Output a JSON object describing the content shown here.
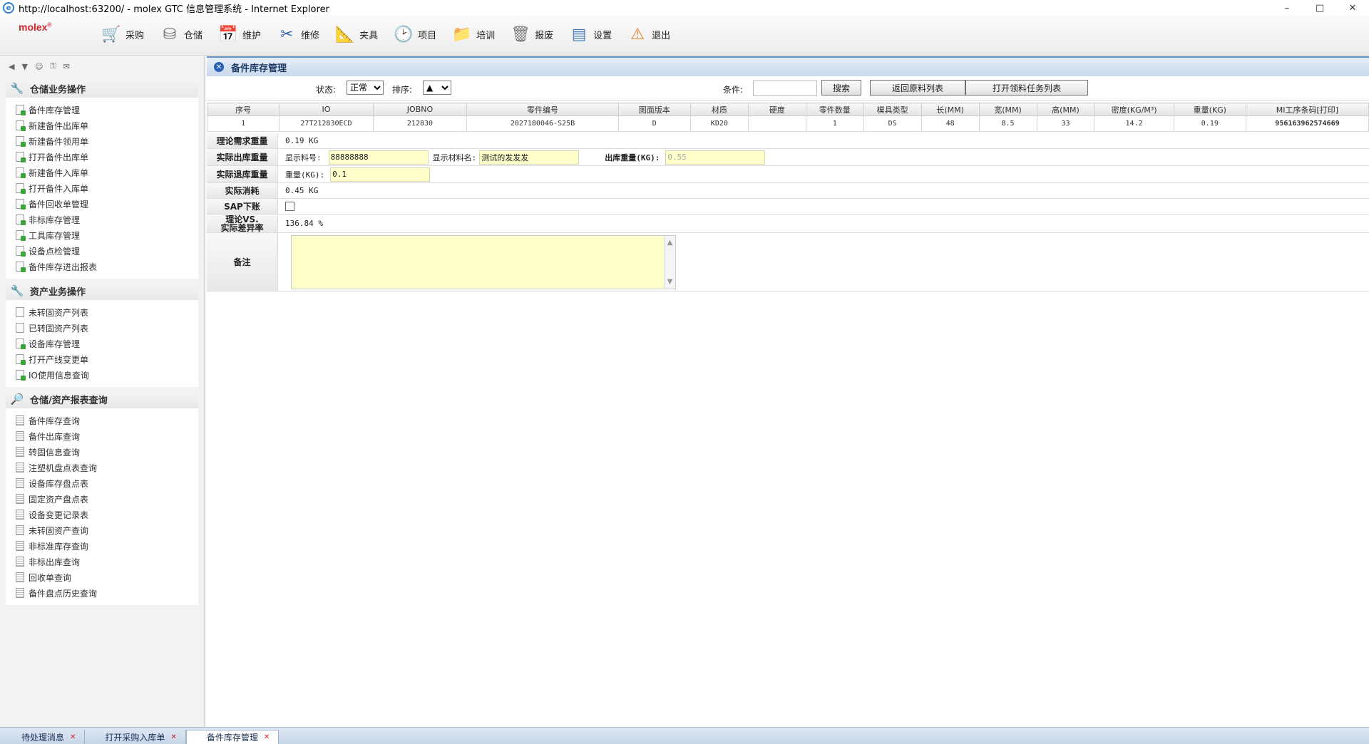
{
  "window": {
    "title": "http://localhost:63200/ - molex GTC 信息管理系统 - Internet Explorer",
    "controls": [
      "–",
      "□",
      "✕"
    ]
  },
  "toolbar": {
    "logo": "molex",
    "buttons": [
      {
        "label": "采购",
        "icon": "cart-icon",
        "color": "#c0392b"
      },
      {
        "label": "仓储",
        "icon": "database-icon",
        "color": "#6b6b6b"
      },
      {
        "label": "维护",
        "icon": "calendar-icon",
        "color": "#b33"
      },
      {
        "label": "维修",
        "icon": "tools-icon",
        "color": "#3a6fb0"
      },
      {
        "label": "夹具",
        "icon": "ruler-icon",
        "color": "#8a6a2a"
      },
      {
        "label": "项目",
        "icon": "clock-icon",
        "color": "#2a62b8"
      },
      {
        "label": "培训",
        "icon": "folder-icon",
        "color": "#2a7fd4"
      },
      {
        "label": "报废",
        "icon": "trash-icon",
        "color": "#777"
      },
      {
        "label": "设置",
        "icon": "settings-icon",
        "color": "#4a7fb6"
      },
      {
        "label": "退出",
        "icon": "warning-icon",
        "color": "#e67e22"
      }
    ]
  },
  "sidebar": {
    "sections": [
      {
        "title": "仓储业务操作",
        "items": [
          "备件库存管理",
          "新建备件出库单",
          "新建备件领用单",
          "打开备件出库单",
          "新建备件入库单",
          "打开备件入库单",
          "备件回收单管理",
          "非标库存管理",
          "工具库存管理",
          "设备点检管理",
          "备件库存进出报表"
        ]
      },
      {
        "title": "资产业务操作",
        "items": [
          "未转固资产列表",
          "已转固资产列表",
          "设备库存管理",
          "打开产线变更单",
          "IO使用信息查询"
        ]
      },
      {
        "title": "仓储/资产报表查询",
        "items": [
          "备件库存查询",
          "备件出库查询",
          "转固信息查询",
          "注塑机盘点表查询",
          "设备库存盘点表",
          "固定资产盘点表",
          "设备变更记录表",
          "未转固资产查询",
          "非标准库存查询",
          "非标出库查询",
          "回收单查询",
          "备件盘点历史查询"
        ]
      }
    ]
  },
  "panel": {
    "title": "备件库存管理",
    "filters": {
      "status_label": "状态:",
      "status_value": "正常",
      "sort_label": "排序:",
      "sort_value": "▲",
      "cond_label": "条件:",
      "cond_value": "",
      "search_btn": "搜索",
      "back_btn": "返回原料列表",
      "open_btn": "打开领料任务列表"
    },
    "table": {
      "headers": [
        "序号",
        "IO",
        "JOBNO",
        "零件编号",
        "图面版本",
        "材质",
        "硬度",
        "零件数量",
        "模具类型",
        "长(MM)",
        "宽(MM)",
        "高(MM)",
        "密度(KG/M³)",
        "重量(KG)",
        "MI工序条码[打印]"
      ],
      "rows": [
        [
          "1",
          "27T212830ECD",
          "212830",
          "2027180046-S25B",
          "D",
          "KD20",
          "",
          "1",
          "DS",
          "48",
          "8.5",
          "33",
          "14.2",
          "0.19",
          "956163962574669"
        ]
      ]
    },
    "form": {
      "theory_label": "理论需求重量",
      "theory_value": "0.19 KG",
      "actual_out_label": "实际出库重量",
      "show_material_no_label": "显示料号:",
      "show_material_no_value": "88888888",
      "show_material_name_label": "显示材料名:",
      "show_material_name_value": "测试的发发发",
      "out_weight_label": "出库重量(KG):",
      "out_weight_placeholder": "0.55",
      "actual_return_label": "实际退库重量",
      "return_weight_label": "重量(KG):",
      "return_weight_value": "0.1",
      "actual_consume_label": "实际消耗",
      "actual_consume_value": "0.45 KG",
      "sap_label": "SAP下账",
      "variance_label_1": "理论VS.",
      "variance_label_2": "实际差异率",
      "variance_value": "136.84 %",
      "remark_label": "备注"
    }
  },
  "tabs": [
    {
      "label": "待处理消息",
      "active": false
    },
    {
      "label": "打开采购入库单",
      "active": false
    },
    {
      "label": "备件库存管理",
      "active": true
    }
  ]
}
